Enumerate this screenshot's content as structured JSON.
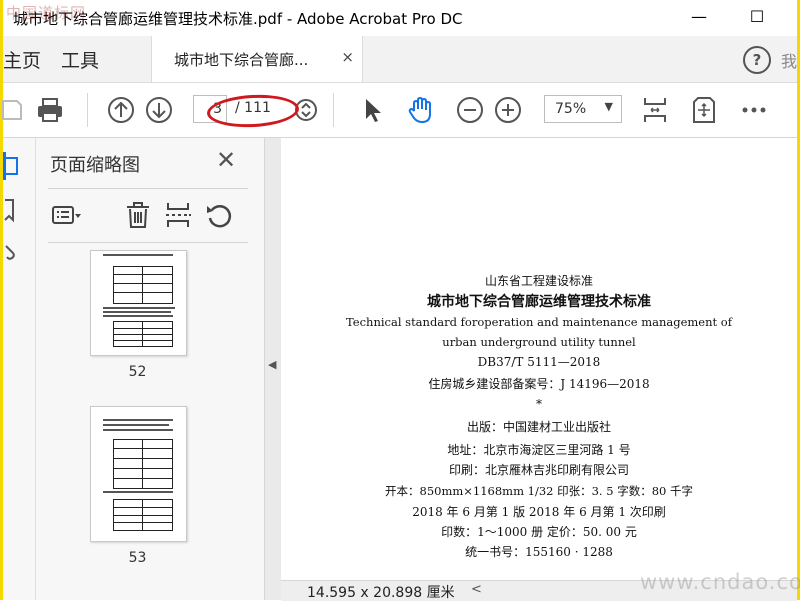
{
  "window": {
    "title": "城市地下综合管廊运维管理技术标准.pdf - Adobe Acrobat Pro DC",
    "watermark_top_left": "中国道标网",
    "minimize_glyph": "—",
    "maximize_glyph": "☐"
  },
  "tabs": {
    "home_label": "主页",
    "tools_label": "工具",
    "doc_tab_label": "城市地下综合管廊...",
    "doc_tab_close": "×",
    "help_glyph": "?",
    "more_label": "我"
  },
  "toolbar": {
    "page_number": "3",
    "page_total": "/ 111",
    "zoom": "75%",
    "zoom_caret": "▼",
    "annotation_color": "#d0191f",
    "accent_color": "#1473e6"
  },
  "sidebar": {
    "title": "页面缩略图",
    "close_glyph": "✕",
    "thumbnails": [
      {
        "page": "52"
      },
      {
        "page": "53"
      }
    ]
  },
  "document": {
    "lines": [
      "山东省工程建设标准",
      "城市地下综合管廊运维管理技术标准",
      "Technical standard foroperation and maintenance management of",
      "urban underground utility tunnel",
      "DB37/T 5111—2018",
      "住房城乡建设部备案号：J 14196—2018",
      "*",
      "出版：中国建材工业出版社",
      "地址：北京市海淀区三里河路 1 号",
      "印刷：北京雁林吉兆印刷有限公司",
      "开本：850mm×1168mm   1/32   印张：3. 5   字数：80 千字",
      "2018 年 6 月第 1 版   2018 年 6 月第 1 次印刷",
      "印数：1～1000 册   定价：50. 00 元",
      "统一书号：155160 · 1288"
    ]
  },
  "statusbar": {
    "page_size": "14.595 x 20.898 厘米",
    "scroll_left": "<"
  },
  "watermark_bottom_right": "www.cndao.com"
}
